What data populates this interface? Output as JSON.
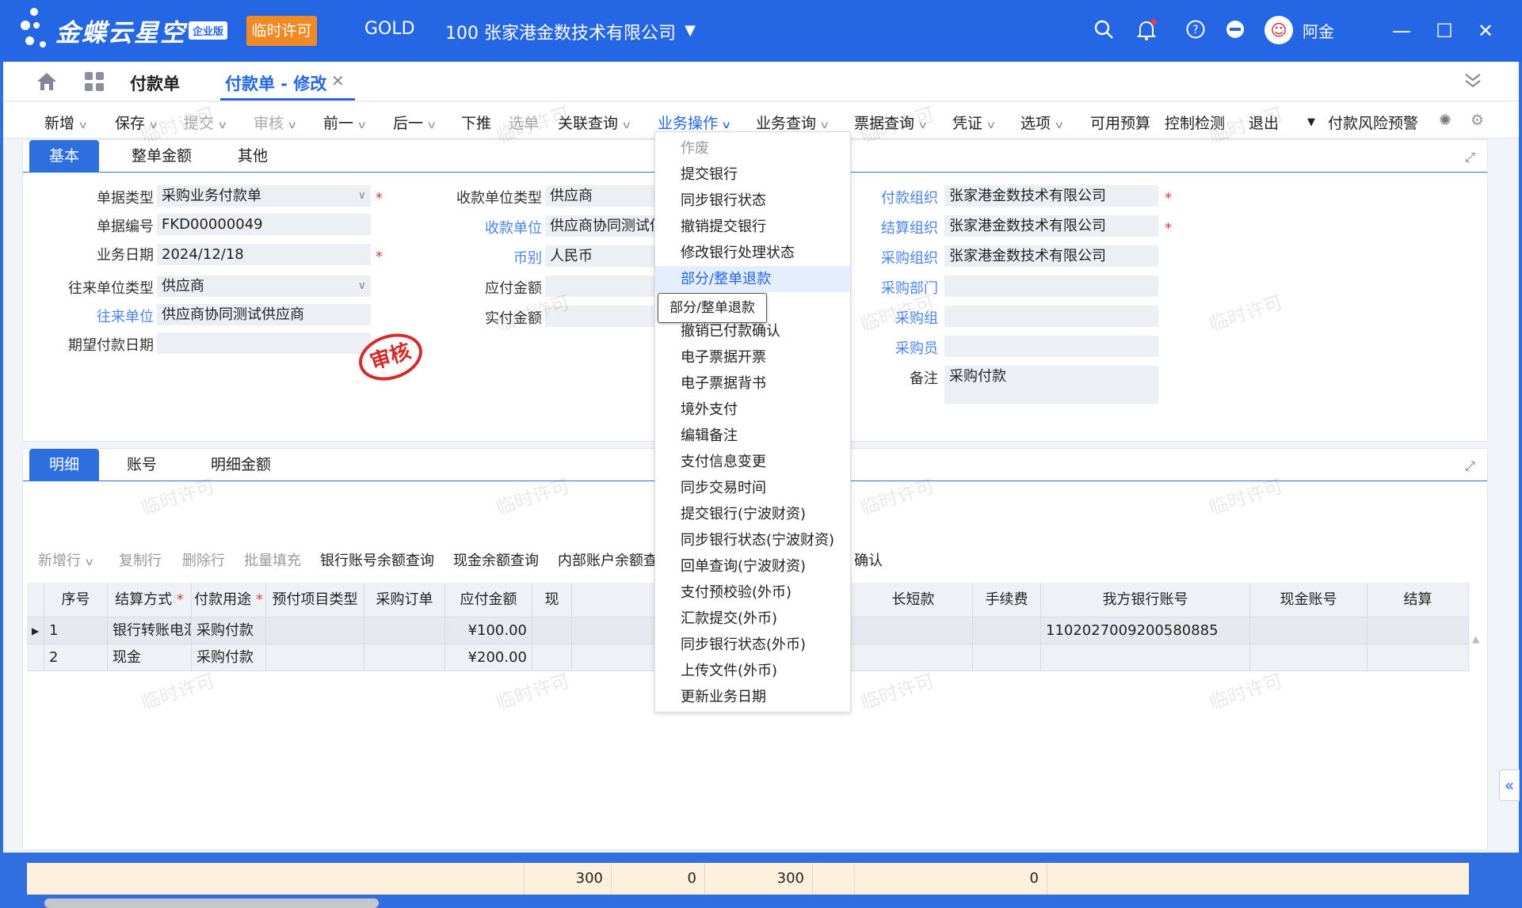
{
  "titlebar": {
    "brand": "金蝶云星空",
    "edition": "企业版",
    "license": "临时许可",
    "product": "GOLD",
    "org": "100  张家港金数技术有限公司",
    "user": "阿金"
  },
  "tabs": {
    "home": "付款单",
    "active": "付款单 - 修改"
  },
  "toolbar": [
    "新增",
    "保存",
    "提交",
    "审核",
    "前一",
    "后一",
    "下推",
    "选单",
    "关联查询",
    "业务操作",
    "业务查询",
    "票据查询",
    "凭证",
    "选项",
    "可用预算",
    "控制检测",
    "退出",
    "付款风险预警"
  ],
  "header_tabs": [
    "基本",
    "整单金额",
    "其他"
  ],
  "form": {
    "col1": [
      {
        "label": "单据类型",
        "value": "采购业务付款单"
      },
      {
        "label": "单据编号",
        "value": "FKD00000049"
      },
      {
        "label": "业务日期",
        "value": "2024/12/18"
      },
      {
        "label": "往来单位类型",
        "value": "供应商"
      },
      {
        "label": "往来单位",
        "value": "供应商协同测试供应商"
      },
      {
        "label": "期望付款日期",
        "value": ""
      }
    ],
    "col2": [
      {
        "label": "收款单位类型",
        "value": "供应商"
      },
      {
        "label": "收款单位",
        "value": "供应商协同测试供"
      },
      {
        "label": "币别",
        "value": "人民币"
      },
      {
        "label": "应付金额",
        "value": ""
      },
      {
        "label": "实付金额",
        "value": ""
      }
    ],
    "col3": [
      {
        "label": "付款组织",
        "value": "张家港金数技术有限公司"
      },
      {
        "label": "结算组织",
        "value": "张家港金数技术有限公司"
      },
      {
        "label": "采购组织",
        "value": "张家港金数技术有限公司"
      },
      {
        "label": "采购部门",
        "value": ""
      },
      {
        "label": "采购组",
        "value": ""
      },
      {
        "label": "采购员",
        "value": ""
      },
      {
        "label": "备注",
        "value": "采购付款"
      }
    ],
    "stamp": "审核"
  },
  "detail_tabs": [
    "明细",
    "账号",
    "明细金额"
  ],
  "detail_toolbar": [
    "新增行",
    "复制行",
    "删除行",
    "批量填充",
    "银行账号余额查询",
    "现金余额查询",
    "内部账户余额查",
    "确认"
  ],
  "grid": {
    "columns": [
      "序号",
      "结算方式",
      "付款用途",
      "预付项目类型",
      "采购订单",
      "应付金额",
      "现",
      "长短款",
      "手续费",
      "我方银行账号",
      "现金账号",
      "结算"
    ],
    "rows": [
      [
        "1",
        "银行转账电汇",
        "采购付款",
        "",
        "",
        "¥100.00",
        "",
        "",
        "",
        "1102027009200580885",
        "",
        ""
      ],
      [
        "2",
        "现金",
        "采购付款",
        "",
        "",
        "¥200.00",
        "",
        "",
        "",
        "",
        "",
        ""
      ]
    ],
    "totals": [
      "300",
      "0",
      "300",
      "0"
    ]
  },
  "menu": {
    "items": [
      "作废",
      "提交银行",
      "同步银行状态",
      "撤销提交银行",
      "修改银行处理状态",
      "部分/整单退款",
      "",
      "撤销已付款确认",
      "电子票据开票",
      "电子票据背书",
      "境外支付",
      "编辑备注",
      "支付信息变更",
      "同步交易时间",
      "提交银行(宁波财资)",
      "同步银行状态(宁波财资)",
      "回单查询(宁波财资)",
      "支付预校验(外币)",
      "汇款提交(外币)",
      "同步银行状态(外币)",
      "上传文件(外币)",
      "更新业务日期"
    ],
    "tooltip": "部分/整单退款"
  },
  "watermark": "临时许可"
}
